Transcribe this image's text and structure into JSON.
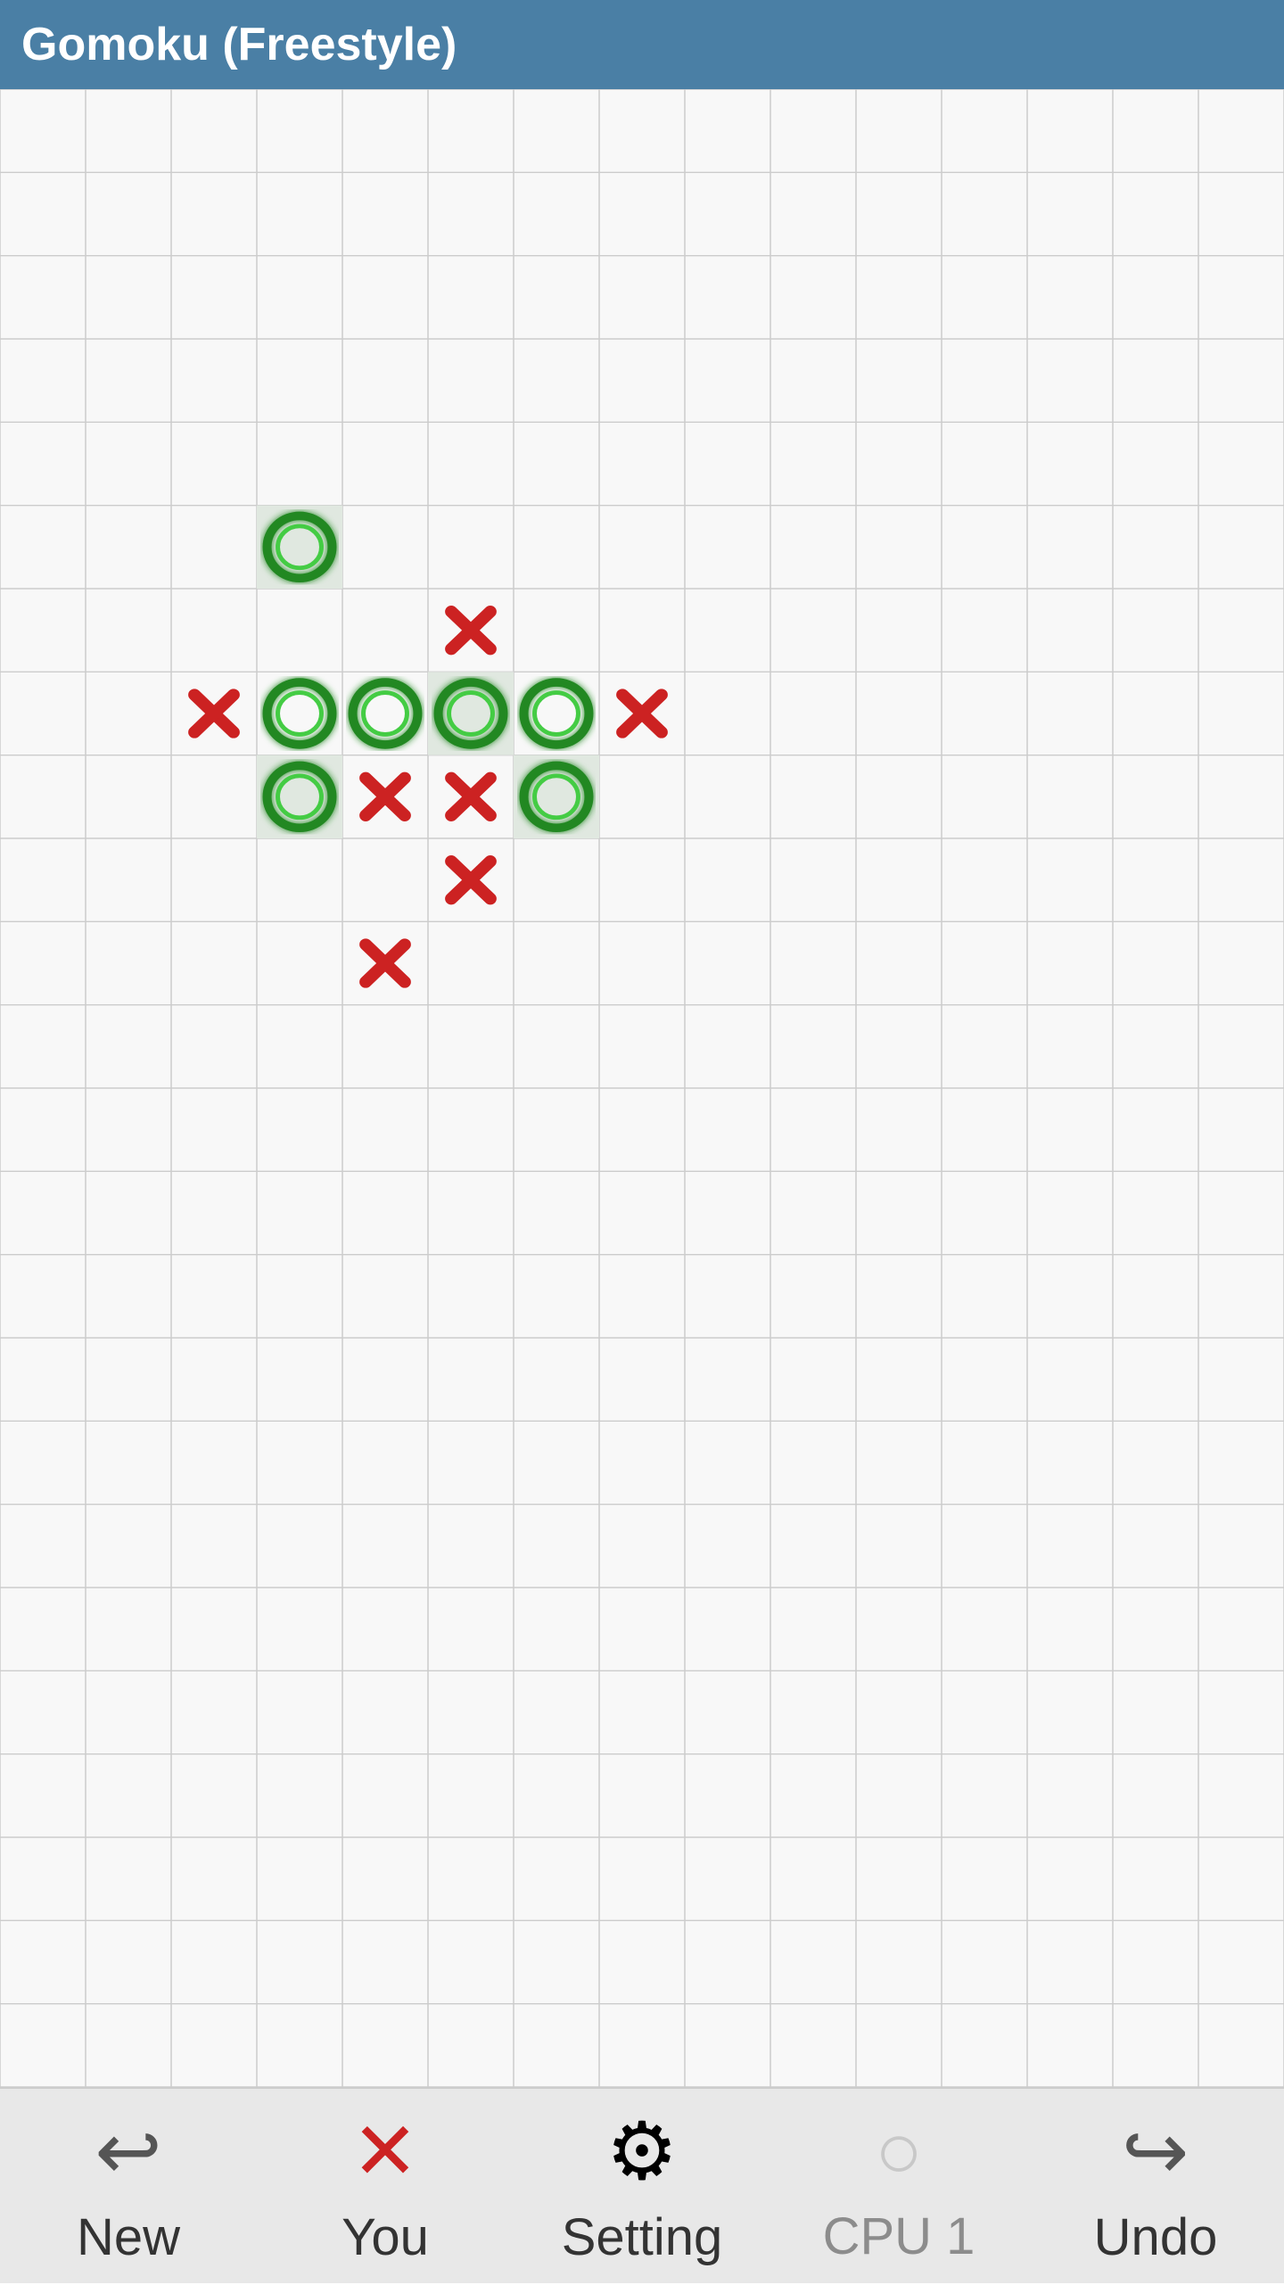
{
  "title": "Gomoku (Freestyle)",
  "board": {
    "cols": 15,
    "rows": 20,
    "cell_size": 96
  },
  "pieces": [
    {
      "type": "O",
      "col": 3,
      "row": 5,
      "highlight": true
    },
    {
      "type": "X",
      "col": 5,
      "row": 6,
      "highlight": false
    },
    {
      "type": "X",
      "col": 2,
      "row": 7,
      "highlight": false
    },
    {
      "type": "O",
      "col": 3,
      "row": 7,
      "highlight": false
    },
    {
      "type": "O",
      "col": 4,
      "row": 7,
      "highlight": false
    },
    {
      "type": "O",
      "col": 5,
      "row": 7,
      "highlight": true
    },
    {
      "type": "O",
      "col": 6,
      "row": 7,
      "highlight": false
    },
    {
      "type": "X",
      "col": 7,
      "row": 7,
      "highlight": false
    },
    {
      "type": "O",
      "col": 3,
      "row": 8,
      "highlight": true
    },
    {
      "type": "X",
      "col": 4,
      "row": 8,
      "highlight": false
    },
    {
      "type": "X",
      "col": 5,
      "row": 8,
      "highlight": false
    },
    {
      "type": "O",
      "col": 6,
      "row": 8,
      "highlight": true
    },
    {
      "type": "X",
      "col": 5,
      "row": 9,
      "highlight": false
    },
    {
      "type": "X",
      "col": 4,
      "row": 10,
      "highlight": false
    }
  ],
  "bottom_bar": {
    "new_label": "New",
    "you_label": "You",
    "setting_label": "Setting",
    "cpu_label": "CPU 1",
    "undo_label": "Undo"
  }
}
